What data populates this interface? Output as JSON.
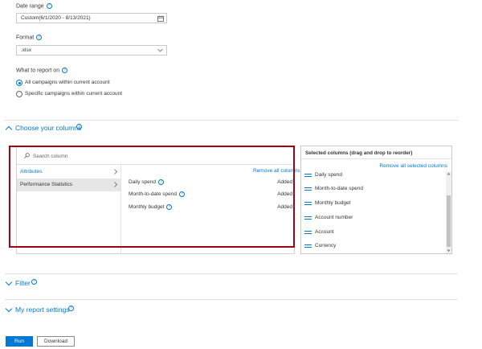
{
  "form": {
    "date_range": {
      "label": "Date range",
      "value": "Custom(6/1/2020 - 8/13/2021)"
    },
    "format": {
      "label": "Format",
      "value": ".xlsx"
    },
    "report_on": {
      "label": "What to report on",
      "options": [
        {
          "label": "All campaigns within current account",
          "selected": true
        },
        {
          "label": "Specific campaigns within current account",
          "selected": false
        }
      ]
    }
  },
  "columns_section": {
    "title": "Choose your columns",
    "search_placeholder": "Search column",
    "categories": [
      "Attributes",
      "Performance Statistics"
    ],
    "remove_all_label": "Remove all columns",
    "available": [
      {
        "name": "Daily spend",
        "status": "Added"
      },
      {
        "name": "Month-to-date spend",
        "status": "Added"
      },
      {
        "name": "Monthly budget",
        "status": "Added"
      }
    ],
    "selected_panel": {
      "title": "Selected columns (drag and drop to reorder)",
      "remove_all_label": "Remove all selected columns",
      "items": [
        "Daily spend",
        "Month-to-date spend",
        "Monthly budget",
        "Account number",
        "Account",
        "Currency"
      ]
    }
  },
  "filter_section": {
    "title": "Filter"
  },
  "settings_section": {
    "title": "My report settings"
  },
  "buttons": {
    "run": "Run",
    "download": "Download"
  },
  "colors": {
    "accent": "#0078d4",
    "highlight_border": "#a4000f"
  }
}
